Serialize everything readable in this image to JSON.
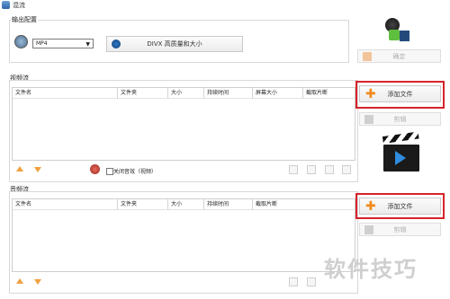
{
  "window": {
    "title": "混流"
  },
  "output": {
    "section_label": "输出配置",
    "format_value": "MP4",
    "quality_button": "DIVX 高质量和大小"
  },
  "actions": {
    "confirm_label": "确定",
    "add_file_video": "添加文件",
    "cut_video": "剪辑",
    "add_file_audio": "添加文件",
    "cut_audio": "剪辑"
  },
  "video": {
    "section_label": "视频流",
    "columns": [
      "文件名",
      "文件夹",
      "大小",
      "持续时间",
      "屏幕大小",
      "截取片断"
    ],
    "mute_label": "关闭音效（视频）"
  },
  "audio": {
    "section_label": "音频流",
    "columns": [
      "文件名",
      "文件夹",
      "大小",
      "持续时间",
      "截取片断"
    ]
  },
  "watermark": "软件技巧",
  "colors": {
    "highlight": "#d6232a",
    "accent": "#f08a1c"
  }
}
